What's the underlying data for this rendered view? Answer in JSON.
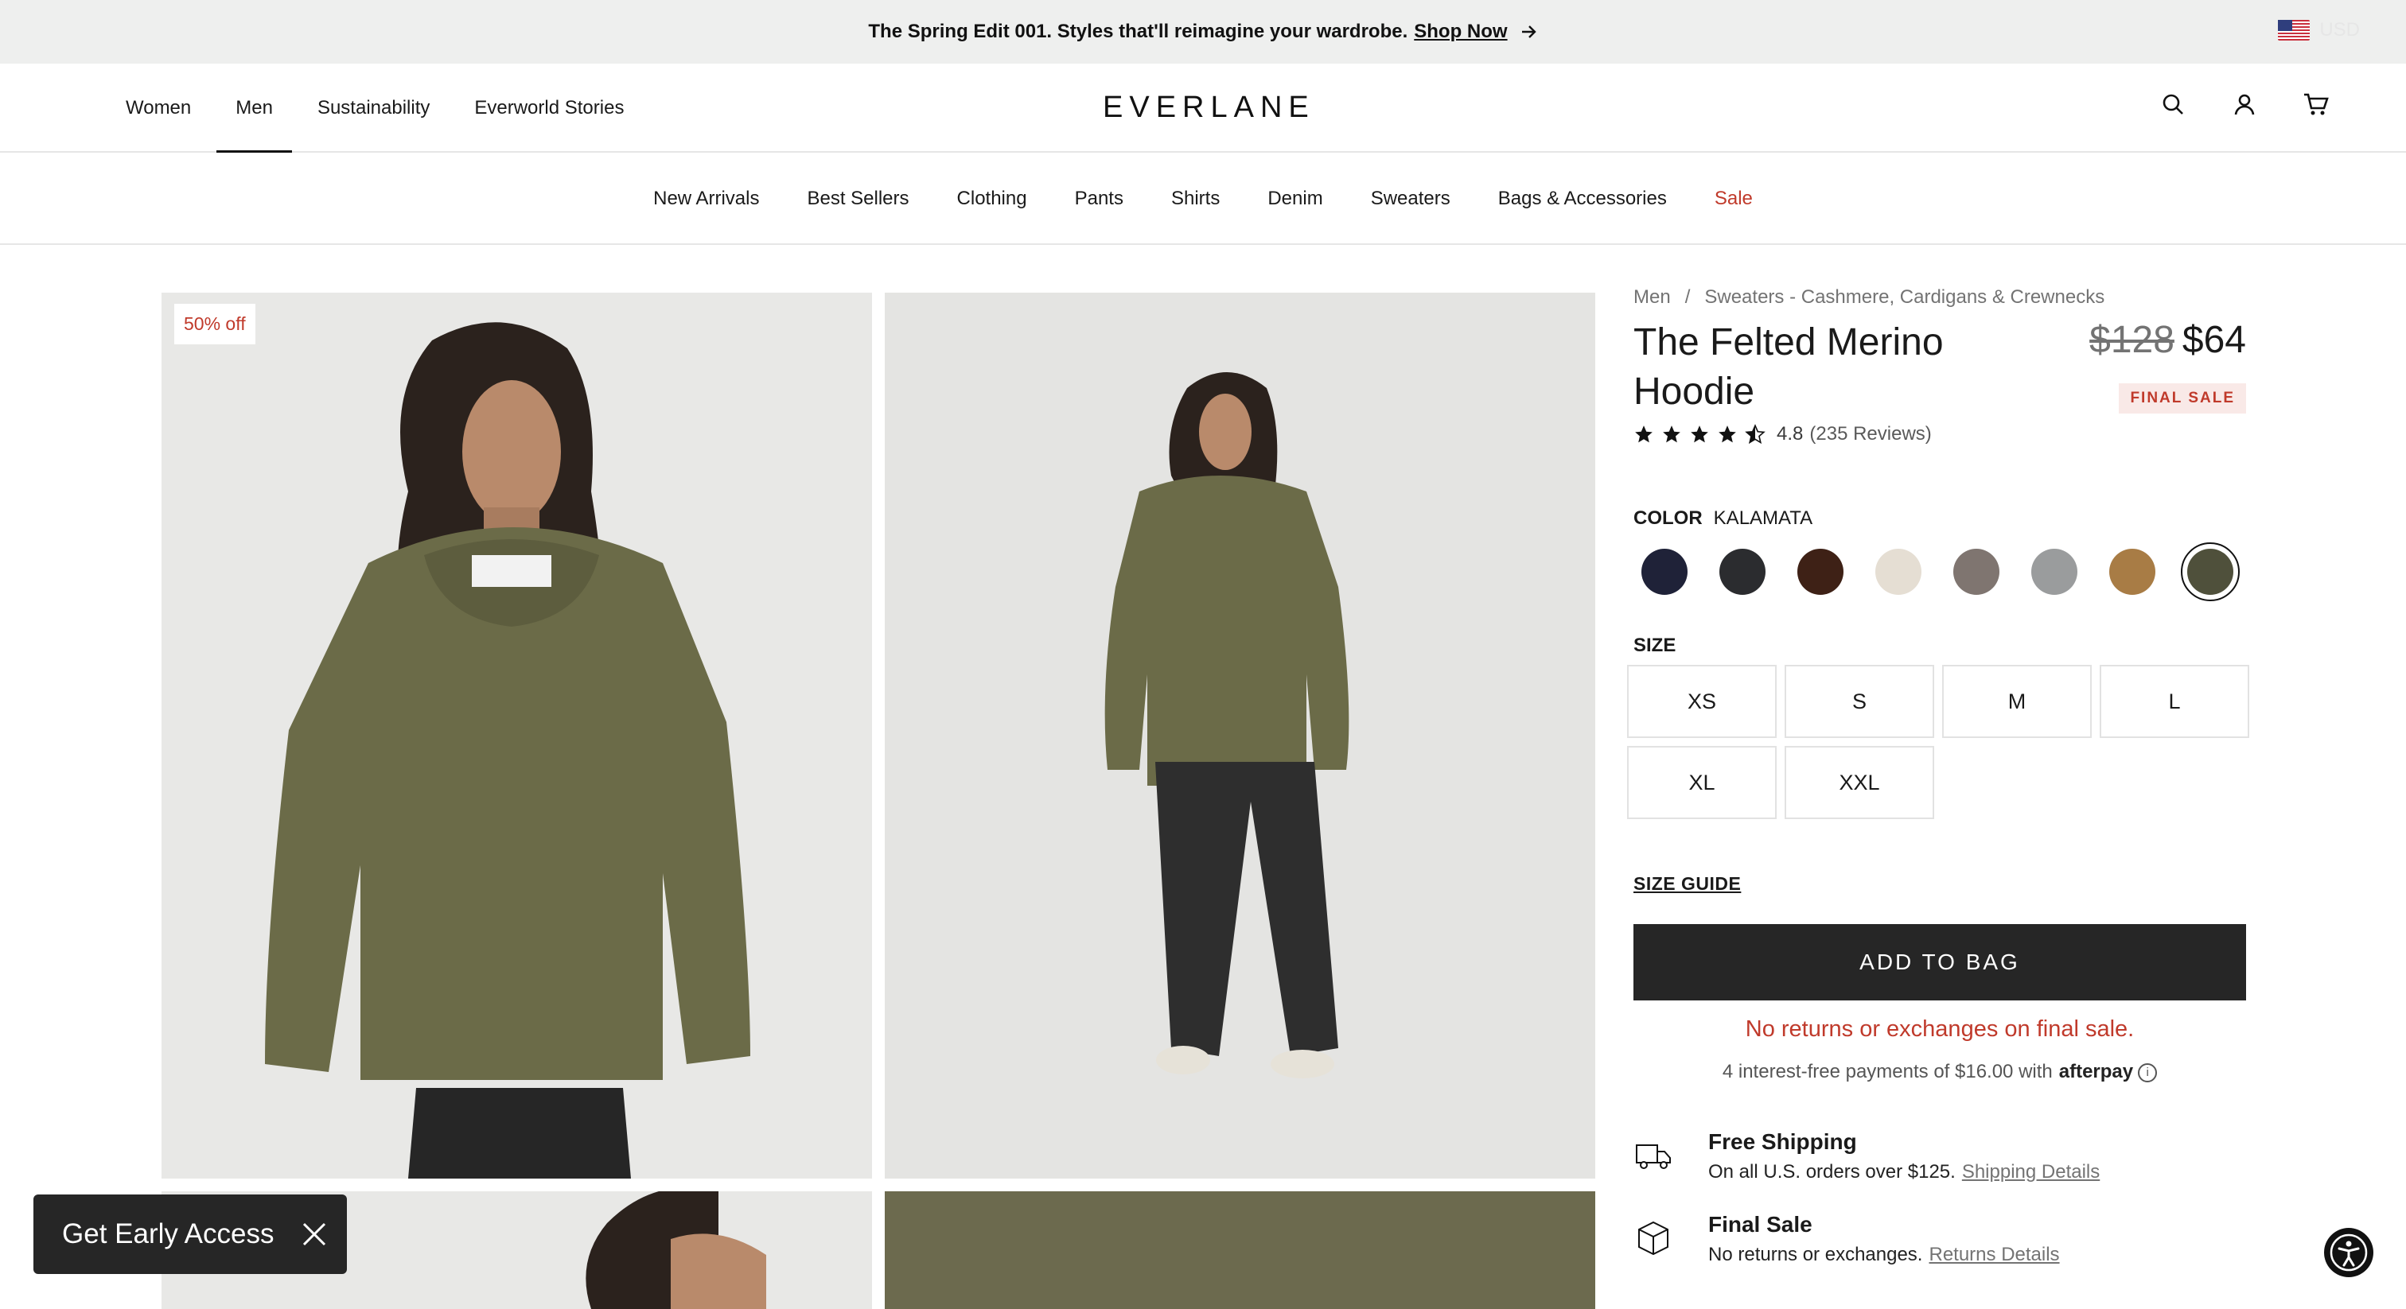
{
  "announcement": {
    "text": "The Spring Edit 001. Styles that'll reimagine your wardrobe.",
    "link": "Shop Now",
    "currency": "USD"
  },
  "header": {
    "nav": [
      "Women",
      "Men",
      "Sustainability",
      "Everworld Stories"
    ],
    "active_nav": "Men",
    "logo": "EVERLANE"
  },
  "categories": [
    "New Arrivals",
    "Best Sellers",
    "Clothing",
    "Pants",
    "Shirts",
    "Denim",
    "Sweaters",
    "Bags & Accessories",
    "Sale"
  ],
  "gallery": {
    "badge": "50% off"
  },
  "product": {
    "breadcrumb": [
      "Men",
      "/",
      "Sweaters - Cashmere, Cardigans & Crewnecks"
    ],
    "title": "The Felted Merino Hoodie",
    "old_price": "$128",
    "price": "$64",
    "final_sale_badge": "FINAL SALE",
    "rating": "4.8",
    "rating_stars": 4.5,
    "reviews": "(235 Reviews)",
    "color_label": "COLOR",
    "color_value": "KALAMATA",
    "swatches": [
      "#1f2238",
      "#2b2c2f",
      "#3e2116",
      "#e5ded3",
      "#7f7570",
      "#9a9c9d",
      "#a87c45",
      "#4f503b"
    ],
    "selected_swatch": 7,
    "size_label": "SIZE",
    "sizes": [
      "XS",
      "S",
      "M",
      "L",
      "XL",
      "XXL"
    ],
    "size_guide": "SIZE GUIDE",
    "add_to_bag": "ADD TO BAG",
    "no_returns": "No returns or exchanges on final sale.",
    "afterpay_text": "4 interest-free payments of $16.00 with",
    "afterpay_brand": "afterpay",
    "features": [
      {
        "title": "Free Shipping",
        "desc": "On all U.S. orders over $125.",
        "link": "Shipping Details",
        "icon": "truck-icon"
      },
      {
        "title": "Final Sale",
        "desc": "No returns or exchanges.",
        "link": "Returns Details",
        "icon": "box-icon"
      }
    ]
  },
  "popup": {
    "early_access": "Get Early Access"
  },
  "colors": {
    "accent_red": "#c03a2b",
    "button_dark": "#262626",
    "announcement_bg": "#eeefee"
  }
}
